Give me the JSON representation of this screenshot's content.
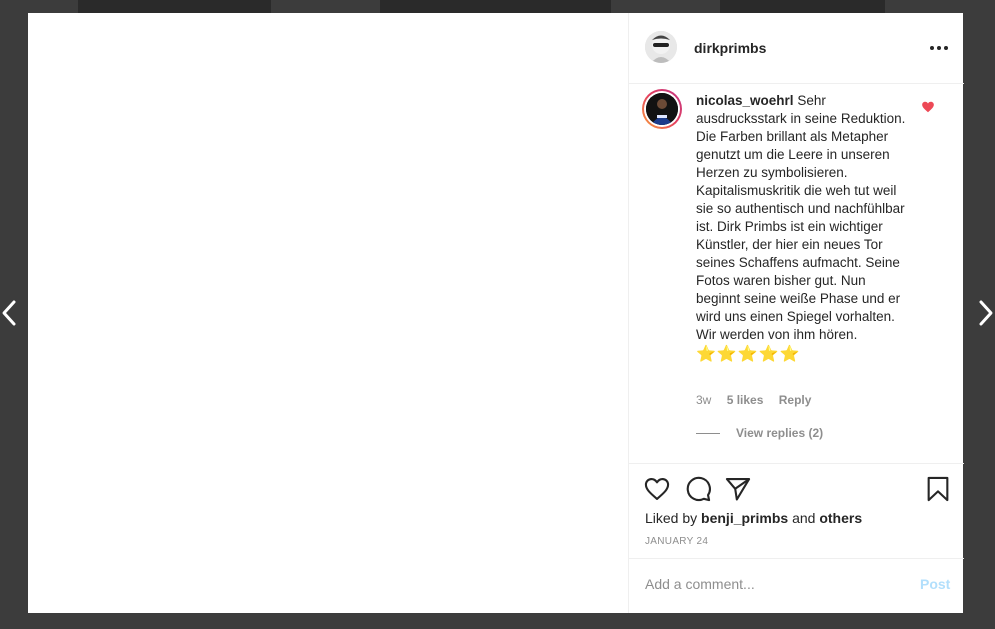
{
  "post": {
    "author": "dirkprimbs",
    "liked_by_prefix": "Liked by",
    "liked_by_user": "benji_primbs",
    "liked_by_and": "and",
    "liked_by_others": "others",
    "date": "JANUARY 24"
  },
  "comment": {
    "username": "nicolas_woehrl",
    "text": "Sehr ausdrucksstark in seine Reduktion. Die Farben brillant als Metapher genutzt um die Leere in unseren Herzen zu symbolisieren. Kapitalismuskritik die weh tut weil sie so authentisch und nachfühlbar ist. Dirk Primbs ist ein wichtiger Künstler, der hier ein neues Tor seines Schaffens aufmacht. Seine Fotos waren bisher gut. Nun beginnt seine weiße Phase und er wird uns einen Spiegel vorhalten. Wir werden von ihm hören.",
    "stars": "⭐⭐⭐⭐⭐",
    "age": "3w",
    "likes": "5 likes",
    "reply_label": "Reply",
    "view_replies": "View replies (2)"
  },
  "composer": {
    "placeholder": "Add a comment...",
    "post_label": "Post"
  },
  "colors": {
    "heart": "#ed4956",
    "post_disabled": "#b2dffc"
  },
  "icons": [
    "chevron-left-icon",
    "chevron-right-icon",
    "more-icon",
    "heart-icon",
    "comment-icon",
    "share-icon",
    "bookmark-icon"
  ]
}
